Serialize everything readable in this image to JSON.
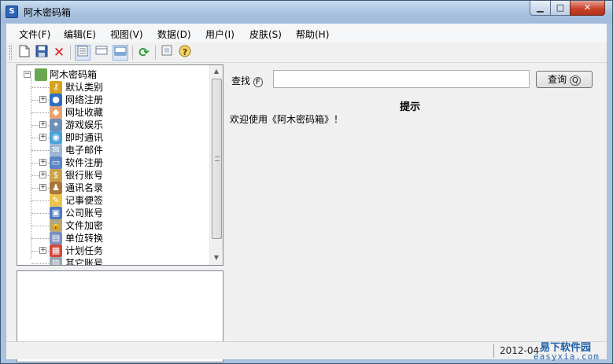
{
  "window": {
    "title": "阿木密码箱",
    "app_icon_letter": "S",
    "minimize_glyph": "▁",
    "maximize_glyph": "□",
    "close_glyph": "✕"
  },
  "menu": [
    "文件(F)",
    "编辑(E)",
    "视图(V)",
    "数据(D)",
    "用户(I)",
    "皮肤(S)",
    "帮助(H)"
  ],
  "toolbar": {
    "icons": [
      "new-file-icon",
      "save-icon",
      "delete-icon",
      "view-detail-icon",
      "view-list-icon",
      "view-card-icon",
      "refresh-icon",
      "about-icon",
      "help-icon"
    ],
    "delete_glyph": "✕",
    "refresh_glyph": "⟳",
    "help_glyph": "?"
  },
  "tree": {
    "root": "阿木密码箱",
    "items": [
      {
        "label": "默认类别",
        "icon": "key-icon",
        "expandable": false,
        "color": "#d8a21f",
        "glyph": "⚷"
      },
      {
        "label": "网络注册",
        "icon": "globe-icon",
        "expandable": true,
        "color": "#2f6fc0",
        "glyph": "●"
      },
      {
        "label": "网址收藏",
        "icon": "bookmark-tag-icon",
        "expandable": false,
        "color": "#e8a270",
        "glyph": "◆"
      },
      {
        "label": "游戏娱乐",
        "icon": "gamepad-icon",
        "expandable": true,
        "color": "#6f8fb5",
        "glyph": "✦"
      },
      {
        "label": "即时通讯",
        "icon": "chat-bubble-icon",
        "expandable": true,
        "color": "#4aa4d9",
        "glyph": "◉"
      },
      {
        "label": "电子邮件",
        "icon": "mail-icon",
        "expandable": false,
        "color": "#9fb6d3",
        "glyph": "✉"
      },
      {
        "label": "软件注册",
        "icon": "window-app-icon",
        "expandable": true,
        "color": "#5a86c6",
        "glyph": "▭"
      },
      {
        "label": "银行账号",
        "icon": "money-bag-icon",
        "expandable": true,
        "color": "#c9a24a",
        "glyph": "$"
      },
      {
        "label": "通讯名录",
        "icon": "contact-book-icon",
        "expandable": true,
        "color": "#a87838",
        "glyph": "♟"
      },
      {
        "label": "记事便签",
        "icon": "note-icon",
        "expandable": false,
        "color": "#e9c44c",
        "glyph": "✎"
      },
      {
        "label": "公司账号",
        "icon": "monitor-icon",
        "expandable": false,
        "color": "#4c78c4",
        "glyph": "▣"
      },
      {
        "label": "文件加密",
        "icon": "lock-file-icon",
        "expandable": false,
        "color": "#b9a673",
        "glyph": "🔒"
      },
      {
        "label": "单位转换",
        "icon": "calculator-icon",
        "expandable": false,
        "color": "#7b8fbf",
        "glyph": "▤"
      },
      {
        "label": "计划任务",
        "icon": "calendar-icon",
        "expandable": true,
        "color": "#d24a3c",
        "glyph": "▦"
      },
      {
        "label": "其它账号",
        "icon": "trash-icon",
        "expandable": false,
        "color": "#9aa6b4",
        "glyph": "▥"
      }
    ],
    "expander_glyph": "+",
    "root_expander_glyph": "−"
  },
  "search": {
    "label": "查找",
    "hotkey": "F",
    "value": "",
    "button_label": "查询",
    "button_hotkey": "Q"
  },
  "content": {
    "tip_title": "提示",
    "welcome_text": "欢迎使用《阿木密码箱》！"
  },
  "status": {
    "text": "2012-04-"
  },
  "watermark": {
    "top": "易下软件园",
    "bottom": "easyxia.com"
  }
}
